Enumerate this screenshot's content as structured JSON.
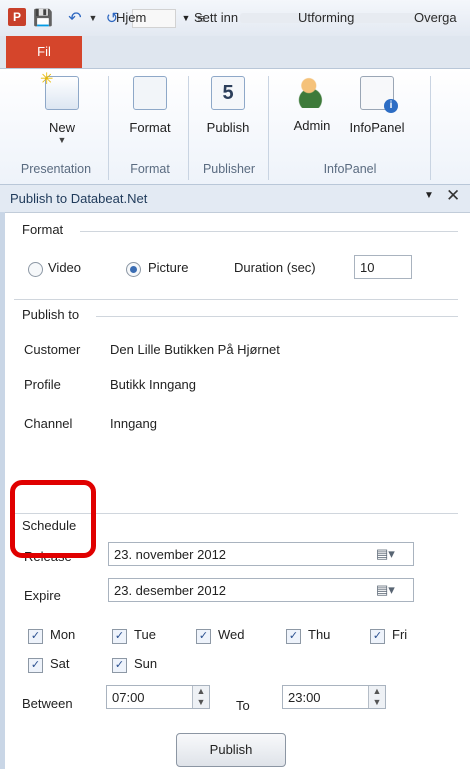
{
  "qat": {
    "app_logo": "P",
    "icons": [
      "save-icon",
      "undo-icon",
      "redo-icon"
    ]
  },
  "tabs": {
    "active": "Fil",
    "items": [
      "Hjem",
      "Sett inn",
      "Utforming",
      "Overga"
    ]
  },
  "ribbon": {
    "buttons": {
      "new": "New",
      "format": "Format",
      "publish": "Publish",
      "admin": "Admin",
      "infopanel": "InfoPanel"
    },
    "groups": {
      "presentation": "Presentation",
      "format": "Format",
      "publisher": "Publisher",
      "infopanel": "InfoPanel"
    }
  },
  "pane": {
    "title": "Publish to Databeat.Net",
    "menu_glyph": "▼",
    "close_glyph": "✕"
  },
  "format_section": {
    "label": "Format",
    "video_label": "Video",
    "picture_label": "Picture",
    "selected": "Picture",
    "duration_label": "Duration (sec)",
    "duration_value": "10"
  },
  "publish_to": {
    "label": "Publish to",
    "customer_label": "Customer",
    "customer_value": "Den Lille Butikken På Hjørnet",
    "profile_label": "Profile",
    "profile_value": "Butikk Inngang",
    "channel_label": "Channel",
    "channel_value": "Inngang"
  },
  "schedule": {
    "label": "Schedule",
    "release_label": "Release",
    "release_value": "23. november 2012",
    "expire_label": "Expire",
    "expire_value": "23. desember 2012",
    "days": [
      "Mon",
      "Tue",
      "Wed",
      "Thu",
      "Fri",
      "Sat",
      "Sun"
    ],
    "days_checked": [
      true,
      true,
      true,
      true,
      true,
      true,
      true
    ],
    "between_label": "Between",
    "from_value": "07:00",
    "to_label": "To",
    "to_value": "23:00"
  },
  "publish_button": "Publish",
  "colors": {
    "file_tab": "#d5452b",
    "highlight": "#e00000",
    "accent": "#3b6db3"
  }
}
